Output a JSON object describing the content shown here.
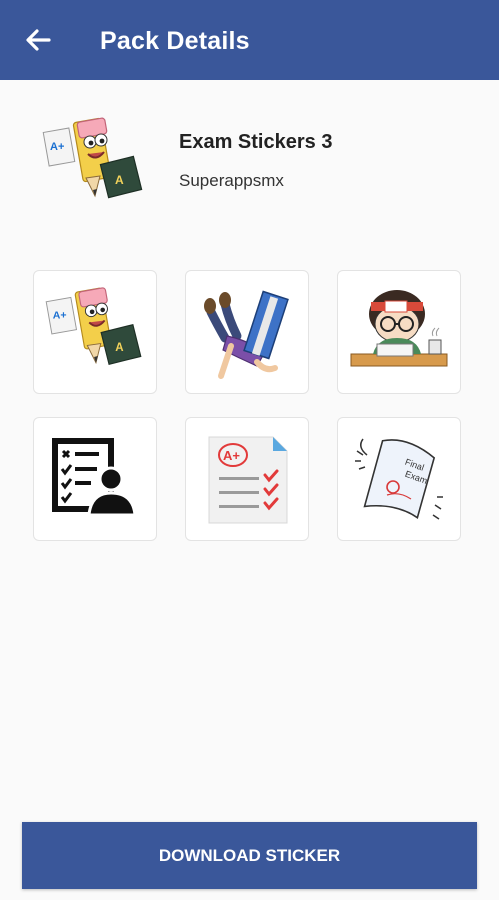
{
  "app_bar": {
    "title": "Pack Details",
    "back_icon": "arrow-back-icon",
    "background": "#3a579a"
  },
  "pack": {
    "name": "Exam Stickers 3",
    "publisher": "Superappsmx",
    "icon": "pencil-book-sticker"
  },
  "stickers": [
    {
      "icon": "pencil-book-sticker"
    },
    {
      "icon": "book-head-fallen-student-sticker"
    },
    {
      "icon": "studying-student-headband-sticker"
    },
    {
      "icon": "checklist-person-sticker"
    },
    {
      "icon": "a-plus-test-paper-sticker"
    },
    {
      "icon": "final-exam-paper-sticker"
    }
  ],
  "download_button": {
    "label": "DOWNLOAD STICKER"
  }
}
